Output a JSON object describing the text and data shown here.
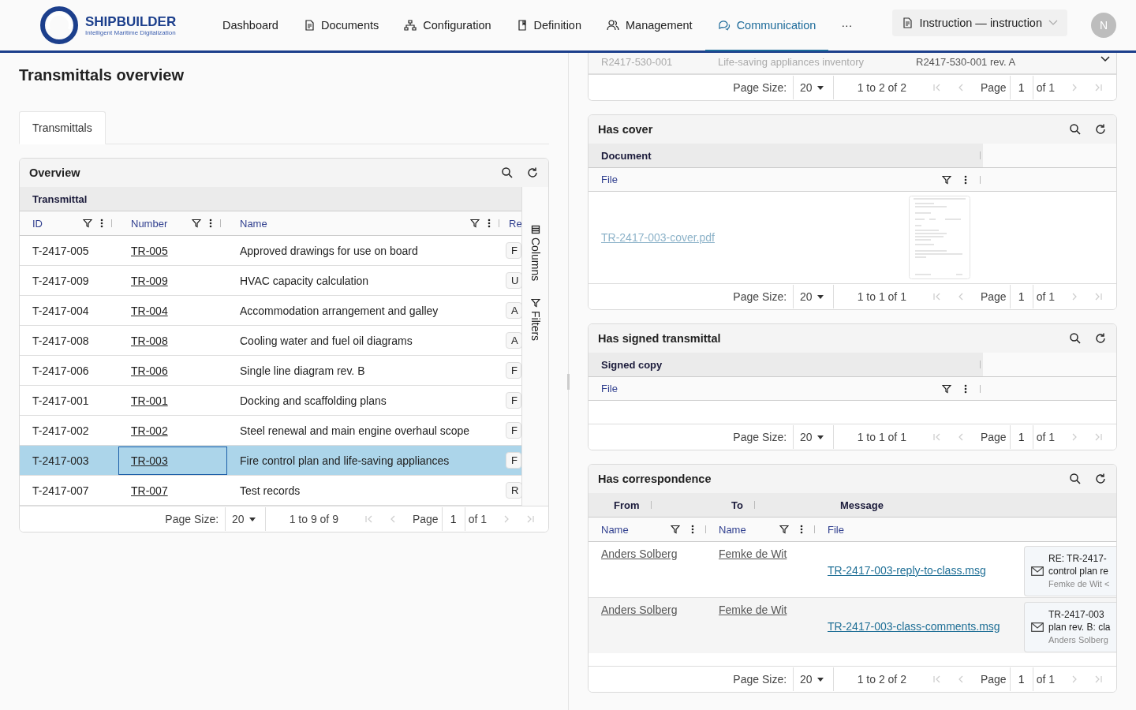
{
  "nav": {
    "logo": {
      "name": "SHIPBUILDER",
      "tagline": "Intelligent Maritime Digitalization"
    },
    "items": [
      {
        "label": "Dashboard",
        "selected": false
      },
      {
        "label": "Documents",
        "selected": false
      },
      {
        "label": "Configuration",
        "selected": false
      },
      {
        "label": "Definition",
        "selected": false
      },
      {
        "label": "Management",
        "selected": false
      },
      {
        "label": "Communication",
        "selected": true
      }
    ],
    "more": "···",
    "context": "Instruction — instruction",
    "avatar": "N"
  },
  "page": {
    "title": "Transmittals overview",
    "tabs": [
      {
        "label": "Transmittals",
        "selected": true
      }
    ]
  },
  "overview": {
    "title": "Overview",
    "group": "Transmittal",
    "columns": [
      "ID",
      "Number",
      "Name",
      "Re"
    ],
    "side_tabs": [
      "Columns",
      "Filters"
    ],
    "rows": [
      {
        "id": "T-2417-005",
        "number": "TR-005",
        "name": "Approved drawings for use on board",
        "column_4": "F",
        "selected": false
      },
      {
        "id": "T-2417-009",
        "number": "TR-009",
        "name": "HVAC capacity calculation",
        "column_4": "U",
        "selected": false
      },
      {
        "id": "T-2417-004",
        "number": "TR-004",
        "name": "Accommodation arrangement and galley",
        "column_4": "A",
        "selected": false
      },
      {
        "id": "T-2417-008",
        "number": "TR-008",
        "name": "Cooling water and fuel oil diagrams",
        "column_4": "A",
        "selected": false
      },
      {
        "id": "T-2417-006",
        "number": "TR-006",
        "name": "Single line diagram rev. B",
        "column_4": "F",
        "selected": false
      },
      {
        "id": "T-2417-001",
        "number": "TR-001",
        "name": "Docking and scaffolding plans",
        "column_4": "F",
        "selected": false
      },
      {
        "id": "T-2417-002",
        "number": "TR-002",
        "name": "Steel renewal and main engine overhaul scope",
        "column_4": "F",
        "selected": false
      },
      {
        "id": "T-2417-003",
        "number": "TR-003",
        "name": "Fire control plan and life-saving appliances",
        "column_4": "F",
        "selected": true
      },
      {
        "id": "T-2417-007",
        "number": "TR-007",
        "name": "Test records",
        "column_4": "R",
        "selected": false
      }
    ],
    "pager": {
      "page_size_label": "Page Size:",
      "page_size": "20",
      "range": "1 to 9 of 9",
      "page_label": "Page",
      "page": "1",
      "of": "of 1"
    }
  },
  "right": {
    "cards": [
      {
        "kind": "partial",
        "rows": [
          {
            "cells": [
              "R2417-530-001",
              "Life-saving appliances inventory",
              "R2417-530-001 rev. A"
            ]
          }
        ],
        "pager": {
          "page_size_label": "Page Size:",
          "page_size": "20",
          "range": "1 to 2 of 2",
          "page_label": "Page",
          "page": "1",
          "of": "of 1"
        }
      },
      {
        "kind": "cover",
        "title": "Has cover",
        "group": "Document",
        "column": "File",
        "rows": [
          {
            "file": "TR-2417-003-cover.pdf"
          }
        ],
        "pager": {
          "page_size_label": "Page Size:",
          "page_size": "20",
          "range": "1 to 1 of 1",
          "page_label": "Page",
          "page": "1",
          "of": "of 1"
        }
      },
      {
        "kind": "signed",
        "title": "Has signed transmittal",
        "group": "Signed copy",
        "column": "File",
        "pager": {
          "page_size_label": "Page Size:",
          "page_size": "20",
          "range": "1 to 1 of 1",
          "page_label": "Page",
          "page": "1",
          "of": "of 1"
        }
      },
      {
        "kind": "correspondence",
        "title": "Has correspondence",
        "groups": [
          "From",
          "To",
          "Message"
        ],
        "columns": [
          "Name",
          "Name",
          "File"
        ],
        "rows": [
          {
            "from": "Anders Solberg",
            "to": "Femke de Wit",
            "file": "TR-2417-003-reply-to-class.msg",
            "preview": [
              "RE: TR-2417-",
              "control plan re",
              "Femke de Wit <"
            ]
          },
          {
            "from": "Anders Solberg",
            "to": "Femke de Wit",
            "file": "TR-2417-003-class-comments.msg",
            "preview": [
              "TR-2417-003",
              "plan rev. B: cla",
              "Anders Solberg"
            ]
          }
        ],
        "pager": {
          "page_size_label": "Page Size:",
          "page_size": "20",
          "range": "1 to 2 of 2",
          "page_label": "Page",
          "page": "1",
          "of": "of 1"
        }
      }
    ]
  }
}
